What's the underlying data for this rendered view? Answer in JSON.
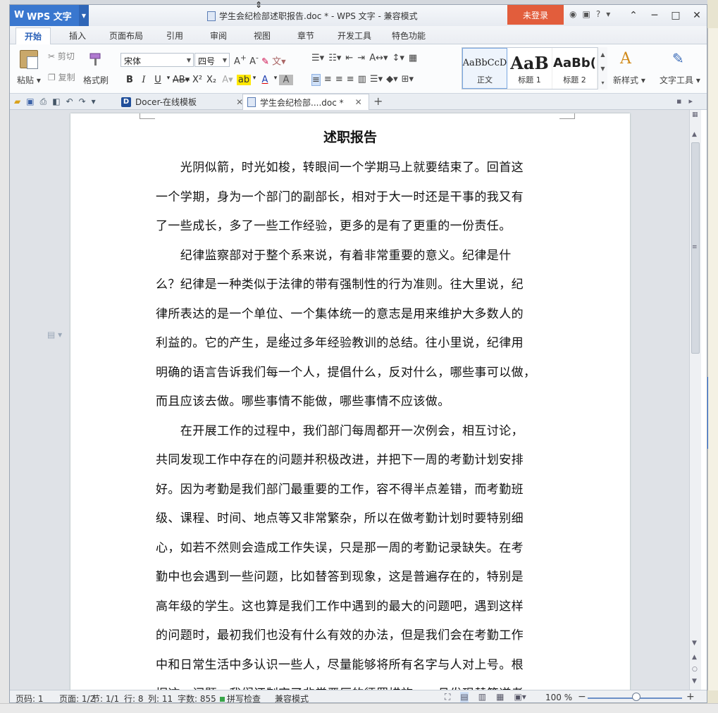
{
  "titlebar": {
    "app_name": "WPS 文字",
    "doc_title": "学生会纪检部述职报告.doc * - WPS 文字 - 兼容模式",
    "login": "未登录"
  },
  "menu": {
    "tabs": [
      "开始",
      "插入",
      "页面布局",
      "引用",
      "审阅",
      "视图",
      "章节",
      "开发工具",
      "特色功能"
    ]
  },
  "ribbon": {
    "paste": "粘贴",
    "cut": "剪切",
    "copy": "复制",
    "format_painter": "格式刷",
    "font_name": "宋体",
    "font_size": "四号",
    "styles": [
      {
        "sample": "AaBbCcD",
        "name": "正文"
      },
      {
        "sample": "AaB",
        "name": "标题 1"
      },
      {
        "sample": "AaBb(",
        "name": "标题 2"
      }
    ],
    "new_style": "新样式",
    "text_tool": "文字工具"
  },
  "tabs": {
    "docer": "Docer-在线模板",
    "current": "学生会纪检部....doc *"
  },
  "document": {
    "title": "述职报告",
    "lines": [
      "　　光阴似箭，时光如梭，转眼间一个学期马上就要结束了。回首这",
      "一个学期，身为一个部门的副部长，相对于大一时还是干事的我又有",
      "了一些成长，多了一些工作经验，更多的是有了更重的一份责任。",
      "　　纪律监察部对于整个系来说，有着非常重要的意义。纪律是什",
      "么？纪律是一种类似于法律的带有强制性的行为准则。往大里说，纪",
      "律所表达的是一个单位、一个集体统一的意志是用来维护大多数人的",
      "利益的。它的产生，是经过多年经验教训的总结。往小里说，纪律用",
      "明确的语言告诉我们每一个人，提倡什么，反对什么，哪些事可以做，",
      "而且应该去做。哪些事情不能做，哪些事情不应该做。",
      "　　在开展工作的过程中，我们部门每周都开一次例会，相互讨论，",
      "共同发现工作中存在的问题并积极改进，并把下一周的考勤计划安排",
      "好。因为考勤是我们部门最重要的工作，容不得半点差错，而考勤班",
      "级、课程、时间、地点等又非常繁杂，所以在做考勤计划时要特别细",
      "心，如若不然则会造成工作失误，只是那一周的考勤记录缺失。在考",
      "勤中也会遇到一些问题，比如替答到现象，这是普遍存在的，特别是",
      "高年级的学生。这也算是我们工作中遇到的最大的问题吧，遇到这样",
      "的问题时，最初我们也没有什么有效的办法，但是我们会在考勤工作",
      "中和日常生活中多认识一些人，尽量能够将所有名字与人对上号。根",
      "据这一问题，我们还制定了非常严厉的惩罚措施，一旦发现替答道者"
    ]
  },
  "status": {
    "page_code": "页码: 1",
    "page": "页面: 1/2",
    "section": "节: 1/1",
    "row": "行: 8",
    "col": "列: 11",
    "word_count": "字数: 855",
    "spell": "拼写检查",
    "compat": "兼容模式",
    "zoom": "100 %"
  }
}
